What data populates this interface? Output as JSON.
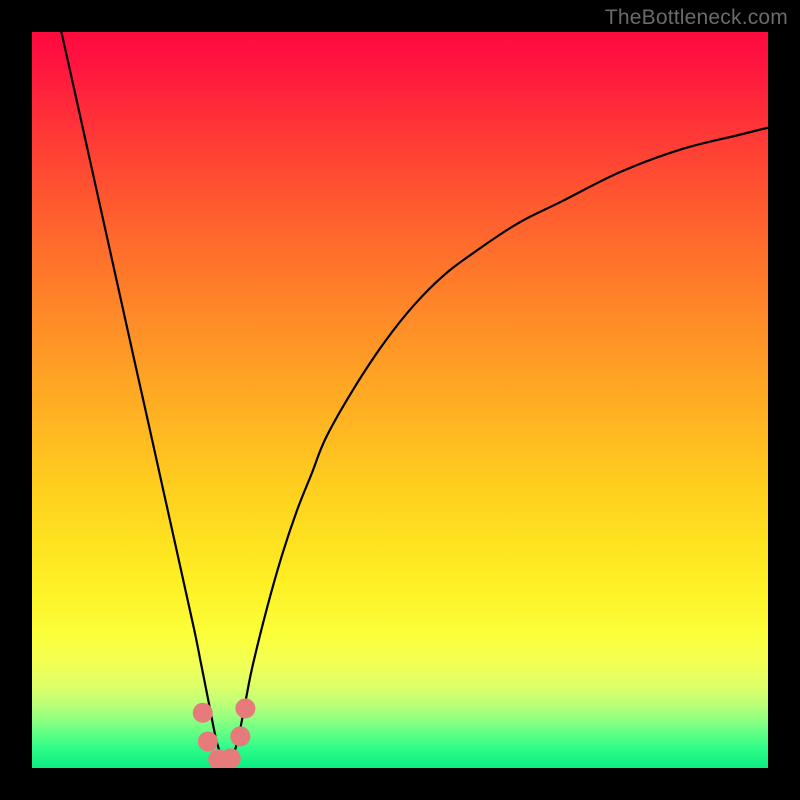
{
  "watermark": "TheBottleneck.com",
  "chart_data": {
    "type": "line",
    "title": "",
    "xlabel": "",
    "ylabel": "",
    "xlim": [
      0,
      100
    ],
    "ylim": [
      0,
      100
    ],
    "series": [
      {
        "name": "bottleneck-curve",
        "description": "V-shaped bottleneck percentage curve with minimum around x≈26",
        "x": [
          4,
          6,
          8,
          10,
          12,
          14,
          16,
          18,
          20,
          22,
          23,
          24,
          25,
          26,
          27,
          28,
          29,
          30,
          32,
          34,
          36,
          38,
          40,
          44,
          48,
          52,
          56,
          60,
          66,
          72,
          80,
          88,
          96,
          100
        ],
        "y": [
          100,
          91,
          82,
          73,
          64,
          55,
          46,
          37,
          28,
          19,
          14,
          9,
          4,
          1,
          1,
          4,
          9,
          14,
          22,
          29,
          35,
          40,
          45,
          52,
          58,
          63,
          67,
          70,
          74,
          77,
          81,
          84,
          86,
          87
        ]
      }
    ],
    "markers": [
      {
        "name": "low-region-dot-1",
        "x": 23.2,
        "y": 7.5
      },
      {
        "name": "low-region-dot-2",
        "x": 23.9,
        "y": 3.6
      },
      {
        "name": "low-region-dot-3",
        "x": 25.3,
        "y": 1.2
      },
      {
        "name": "low-region-dot-4",
        "x": 27.0,
        "y": 1.3
      },
      {
        "name": "low-region-dot-5",
        "x": 28.3,
        "y": 4.3
      },
      {
        "name": "low-region-dot-6",
        "x": 29.0,
        "y": 8.1
      }
    ],
    "gradient_meaning": "background color maps vertical position: red=high bottleneck, green=low bottleneck",
    "annotations": []
  },
  "colors": {
    "marker": "#e77a7a",
    "curve": "#000000",
    "frame": "#000000"
  }
}
